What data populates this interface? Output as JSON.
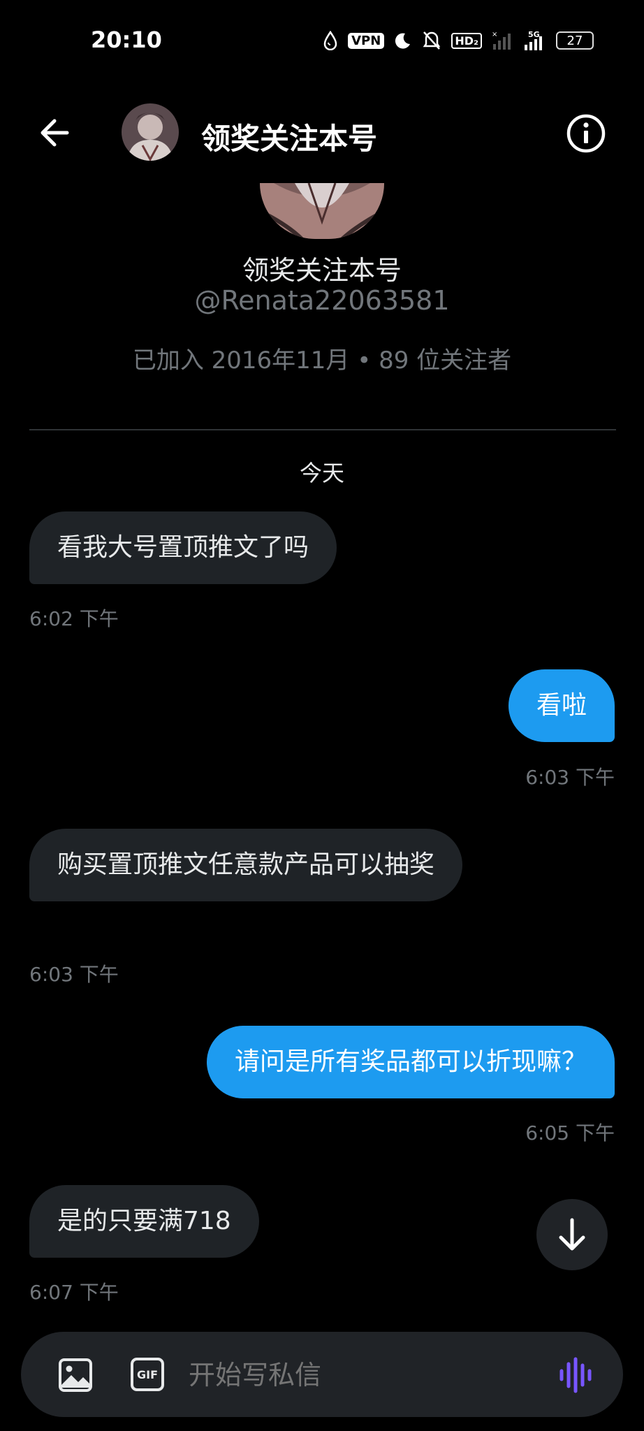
{
  "status_bar": {
    "time": "20:10",
    "vpn": "VPN",
    "hd": "HD₂",
    "network": "5G",
    "battery": "27"
  },
  "header": {
    "title": "领奖关注本号"
  },
  "profile": {
    "name": "领奖关注本号",
    "handle": "@Renata22063581",
    "meta": "已加入 2016年11月 • 89 位关注者"
  },
  "conversation": {
    "day_label": "今天",
    "messages": [
      {
        "direction": "received",
        "text": "看我大号置顶推文了吗",
        "time": "6:02 下午"
      },
      {
        "direction": "sent",
        "text": "看啦",
        "time": "6:03 下午"
      },
      {
        "direction": "received",
        "text": "购买置顶推文任意款产品可以抽奖",
        "time": "6:03 下午"
      },
      {
        "direction": "sent",
        "text": "请问是所有奖品都可以折现嘛？",
        "time": "6:05 下午"
      },
      {
        "direction": "received",
        "text": "是的只要满718",
        "time": "6:07 下午"
      }
    ]
  },
  "composer": {
    "placeholder": "开始写私信",
    "gif_label": "GIF"
  },
  "colors": {
    "sent_bubble": "#1d9bf0",
    "received_bubble": "#1f2327",
    "voice_accent": "#7856ff"
  }
}
